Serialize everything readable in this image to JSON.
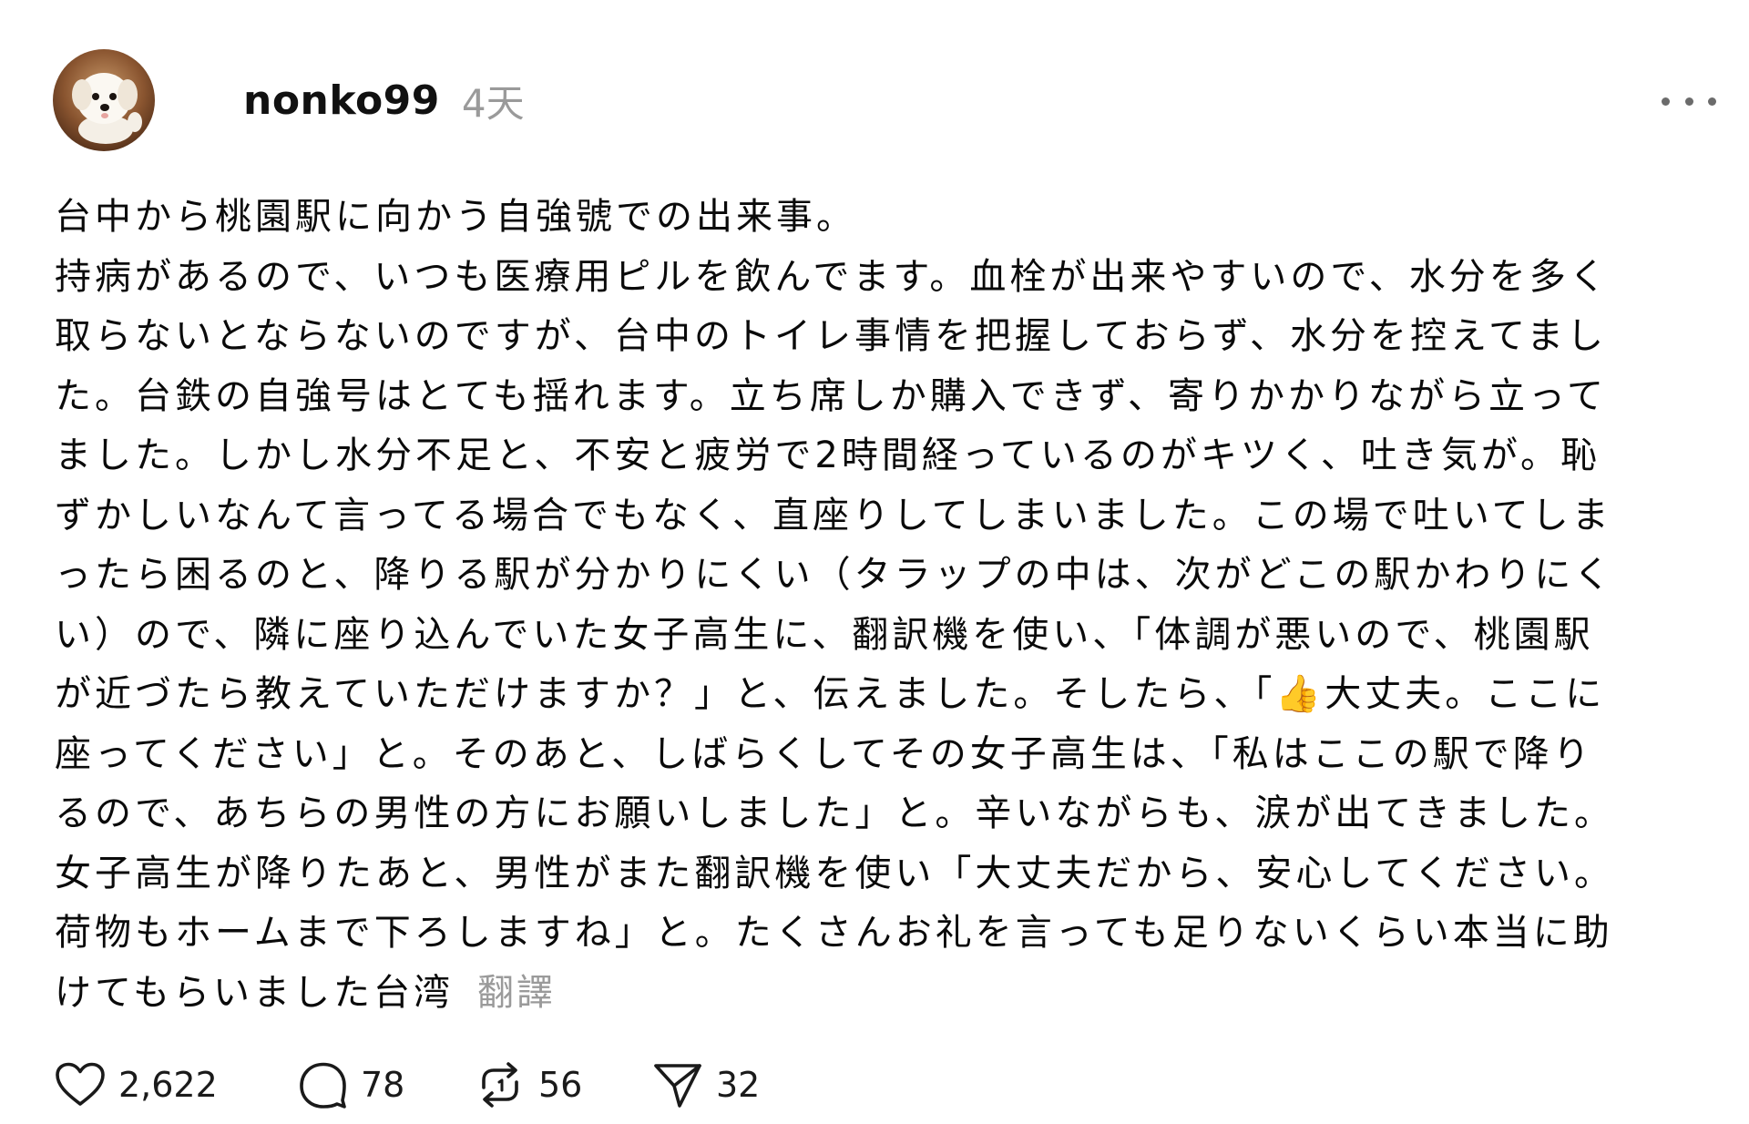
{
  "post": {
    "author": "nonko99",
    "timestamp": "4天",
    "body_lines": [
      "台中から桃園駅に向かう自強號での出来事。",
      "持病があるので、いつも医療用ピルを飲んでます。血栓が出来やすいので、水分を多く",
      "取らないとならないのですが、台中のトイレ事情を把握しておらず、水分を控えてまし",
      "た。台鉄の自強号はとても揺れます。立ち席しか購入できず、寄りかかりながら立って",
      "ました。しかし水分不足と、不安と疲労で2時間経っているのがキツく、吐き気が。恥",
      "ずかしいなんて言ってる場合でもなく、直座りしてしまいました。この場で吐いてしま",
      "ったら困るのと、降りる駅が分かりにくい（タラップの中は、次がどこの駅かわりにく",
      "い）ので、隣に座り込んでいた女子高生に、翻訳機を使い、「体調が悪いので、桃園駅",
      "が近づたら教えていただけますか？」と、伝えました。そしたら、「👍大丈夫。ここに",
      "座ってください」と。そのあと、しばらくしてその女子高生は、「私はここの駅で降り",
      "るので、あちらの男性の方にお願いしました」と。辛いながらも、涙が出てきました。",
      "女子高生が降りたあと、男性がまた翻訳機を使い「大丈夫だから、安心してください。",
      "荷物もホームまで下ろしますね」と。たくさんお礼を言っても足りないくらい本当に助",
      "けてもらいました台湾"
    ],
    "translate_label": "翻譯"
  },
  "actions": {
    "likes": "2,622",
    "replies": "78",
    "reposts": "56",
    "shares": "32"
  },
  "icons": {
    "like": "heart-icon",
    "reply": "comment-bubble-icon",
    "repost": "repost-arrows-icon",
    "share": "send-paper-plane-icon",
    "more": "more-dots-icon"
  },
  "colors": {
    "text": "#0a0a0a",
    "muted": "#9a9a9a",
    "background": "#ffffff"
  }
}
